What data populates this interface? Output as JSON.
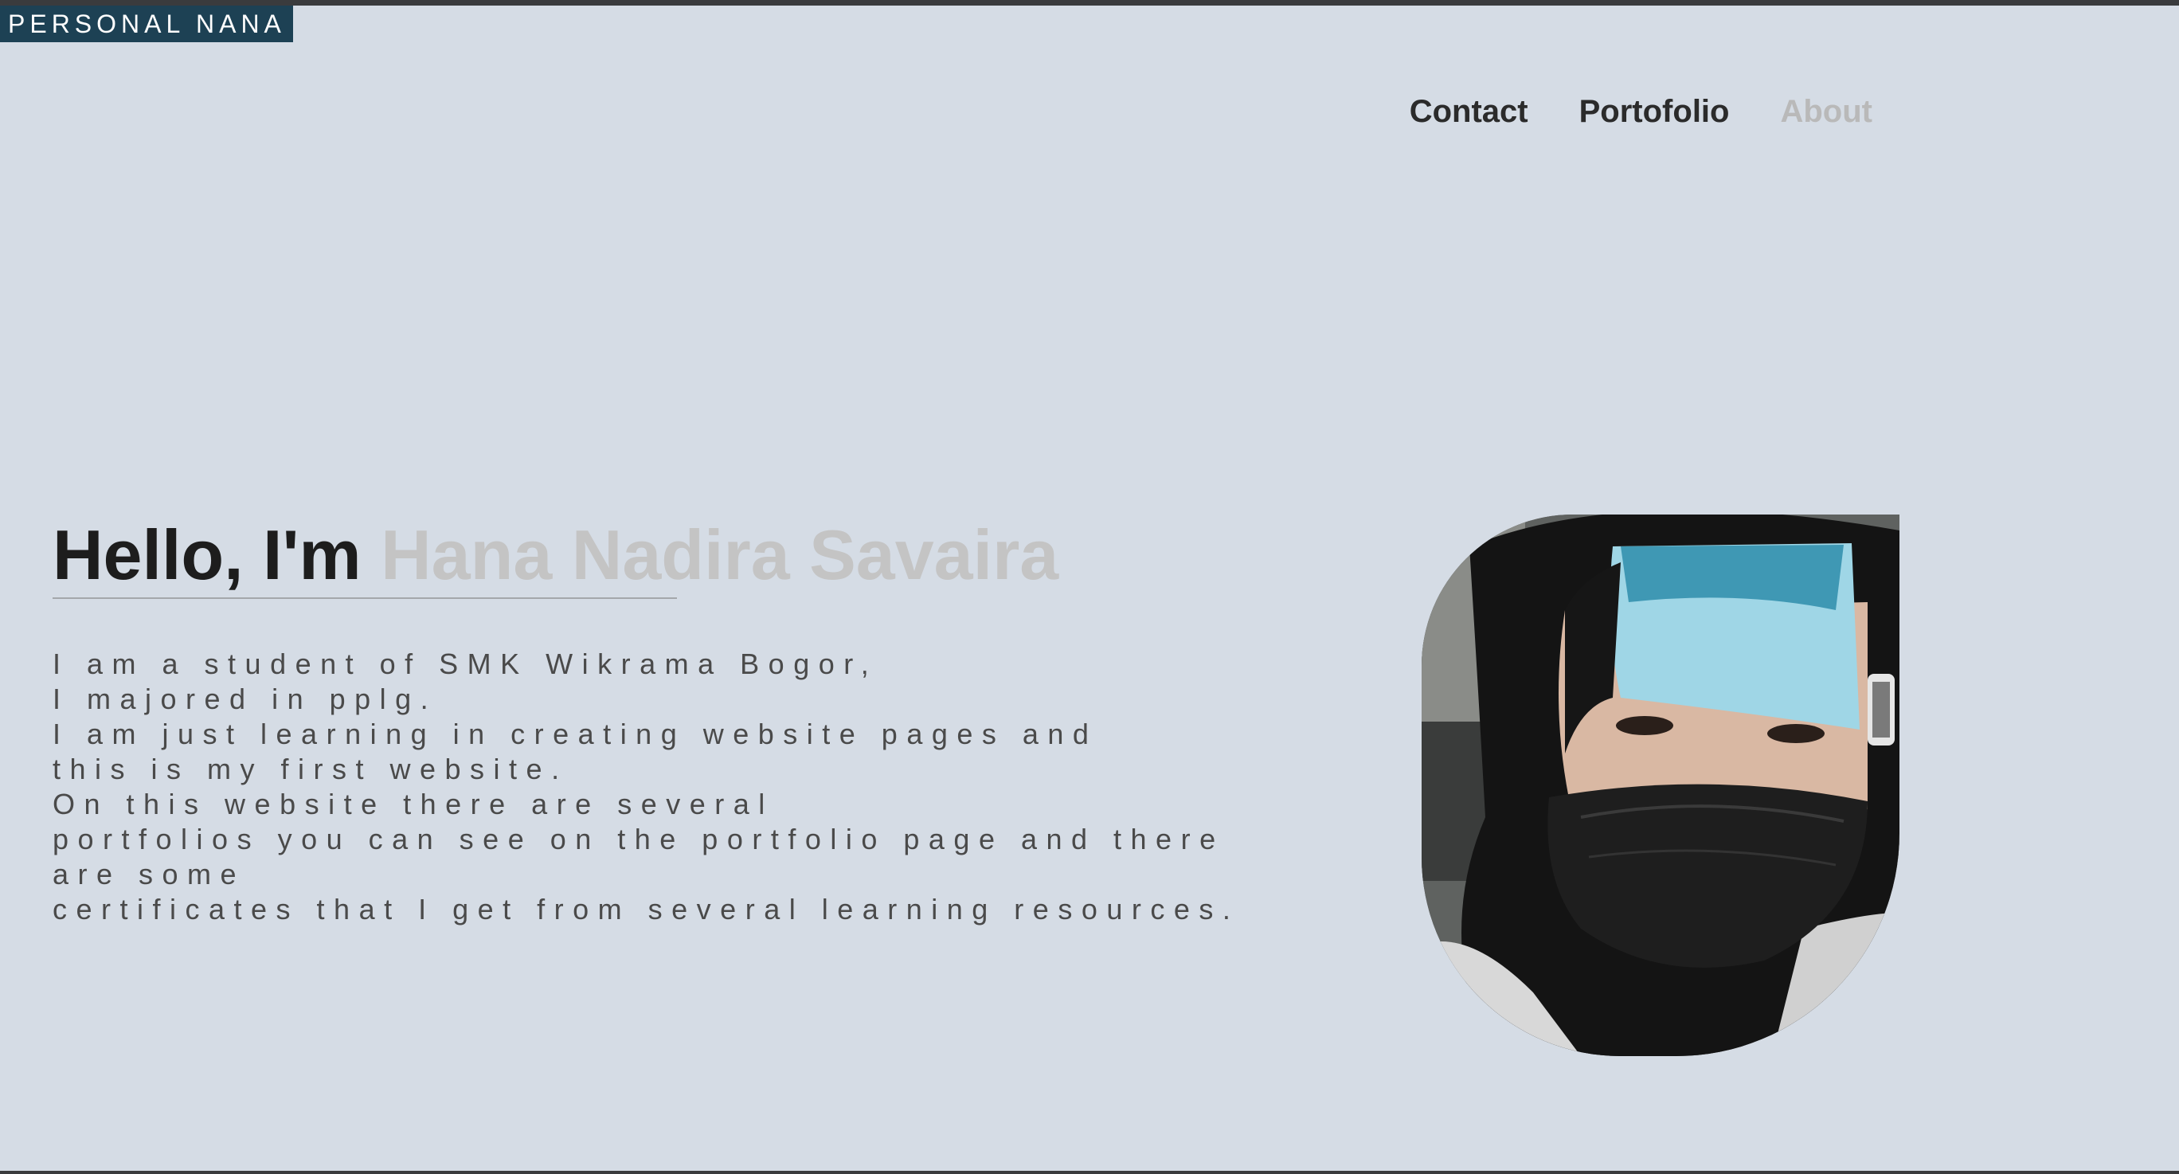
{
  "brand": {
    "label": "PERSONAL NANA"
  },
  "nav": {
    "items": [
      {
        "label": "Contact"
      },
      {
        "label": "Portofolio"
      },
      {
        "label": "About"
      }
    ]
  },
  "hero": {
    "greeting": "Hello, I'm ",
    "name": "Hana Nadira Savaira",
    "bio_lines": [
      "I am a student of SMK Wikrama Bogor,",
      "I majored in pplg.",
      "I am just learning in creating website pages and",
      "this is my first website.",
      "On this website there are several",
      "portfolios you can see on the portfolio page and there",
      "are some",
      "certificates that I get from several learning resources."
    ]
  },
  "colors": {
    "background": "#d5dce5",
    "brand_bg": "#1d4154",
    "text_dark": "#1d1d1d",
    "text_muted": "#c4c4c4",
    "nav_active": "#b9b9b9"
  }
}
